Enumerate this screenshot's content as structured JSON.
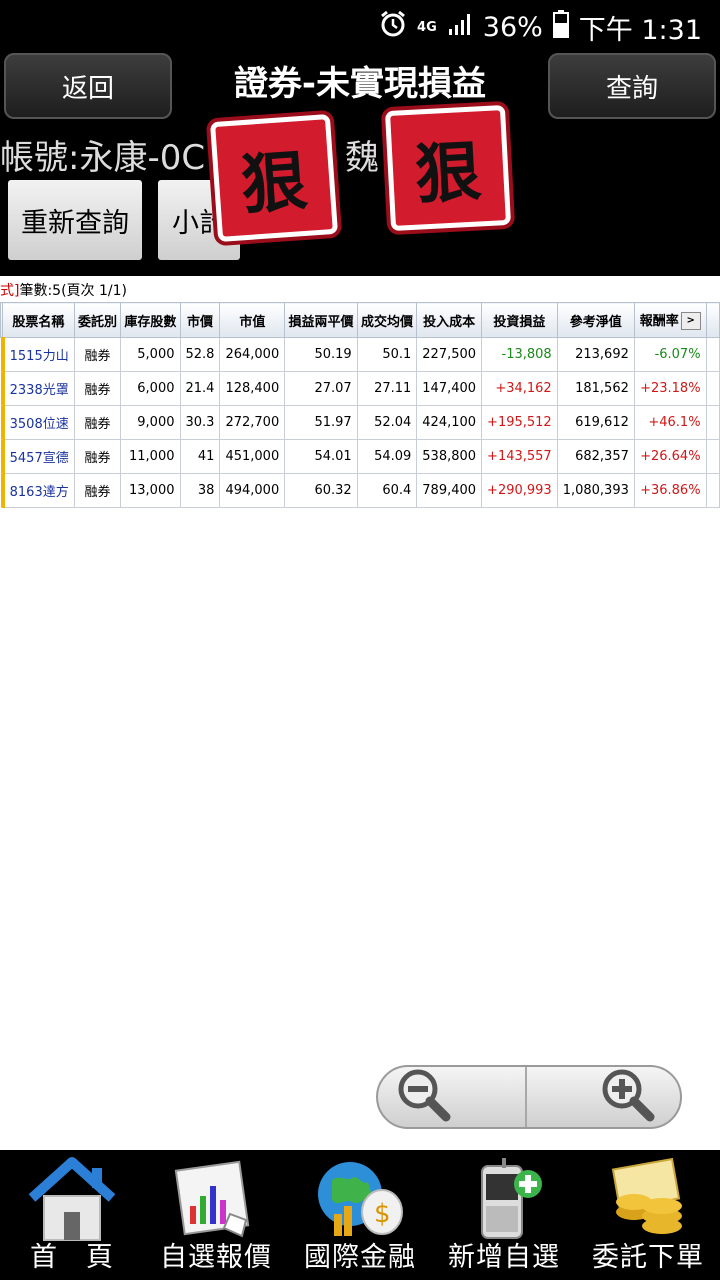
{
  "status_bar": {
    "network": "4G",
    "battery": "36%",
    "time": "下午 1:31"
  },
  "header": {
    "back_label": "返回",
    "title": "證券-未實現損益",
    "query_label": "查詢",
    "account_label": "帳號:永康-0C",
    "owner": "魏",
    "stamp_text": "狠",
    "requery_label": "重新查詢",
    "subtotal_label": "小計"
  },
  "info": {
    "prefix": "式]",
    "text": "筆數:5(頁次 1/1)"
  },
  "table": {
    "columns": [
      "股票名稱",
      "委託別",
      "庫存股數",
      "市價",
      "市值",
      "損益兩平價",
      "成交均價",
      "投入成本",
      "投資損益",
      "參考淨值",
      "報酬率"
    ],
    "more_label": ">",
    "rows": [
      {
        "name": "1515力山",
        "type": "融券",
        "shares": "5,000",
        "price": "52.8",
        "value": "264,000",
        "breakeven": "50.19",
        "avg": "50.1",
        "cost": "227,500",
        "pl": "-13,808",
        "net": "213,692",
        "ret": "-6.07%",
        "sign": "neg"
      },
      {
        "name": "2338光罩",
        "type": "融券",
        "shares": "6,000",
        "price": "21.4",
        "value": "128,400",
        "breakeven": "27.07",
        "avg": "27.11",
        "cost": "147,400",
        "pl": "+34,162",
        "net": "181,562",
        "ret": "+23.18%",
        "sign": "pos"
      },
      {
        "name": "3508位速",
        "type": "融券",
        "shares": "9,000",
        "price": "30.3",
        "value": "272,700",
        "breakeven": "51.97",
        "avg": "52.04",
        "cost": "424,100",
        "pl": "+195,512",
        "net": "619,612",
        "ret": "+46.1%",
        "sign": "pos"
      },
      {
        "name": "5457宣德",
        "type": "融券",
        "shares": "11,000",
        "price": "41",
        "value": "451,000",
        "breakeven": "54.01",
        "avg": "54.09",
        "cost": "538,800",
        "pl": "+143,557",
        "net": "682,357",
        "ret": "+26.64%",
        "sign": "pos"
      },
      {
        "name": "8163達方",
        "type": "融券",
        "shares": "13,000",
        "price": "38",
        "value": "494,000",
        "breakeven": "60.32",
        "avg": "60.4",
        "cost": "789,400",
        "pl": "+290,993",
        "net": "1,080,393",
        "ret": "+36.86%",
        "sign": "pos"
      }
    ]
  },
  "bottom_nav": [
    {
      "label": "首　頁",
      "icon": "home-icon"
    },
    {
      "label": "自選報價",
      "icon": "chart-icon"
    },
    {
      "label": "國際金融",
      "icon": "globe-money-icon"
    },
    {
      "label": "新增自選",
      "icon": "phone-add-icon"
    },
    {
      "label": "委託下單",
      "icon": "coins-icon"
    }
  ],
  "colors": {
    "positive": "#d01818",
    "negative": "#1a8a1a",
    "name": "#1a33a0"
  }
}
